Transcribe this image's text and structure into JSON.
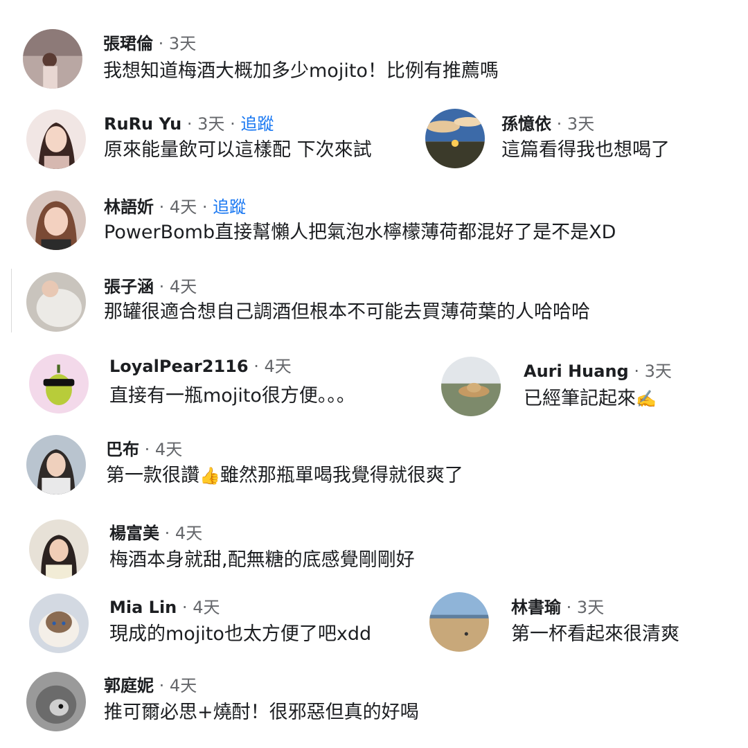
{
  "separator": "·",
  "follow_label": "追蹤",
  "colors": {
    "follow": "#1877f2",
    "meta": "#65676b",
    "text": "#1c1e21"
  },
  "comments": [
    {
      "name": "張珺倫",
      "time": "3天",
      "text": "我想知道梅酒大概加多少mojito！比例有推薦嗎"
    },
    {
      "name": "RuRu Yu",
      "time": "3天",
      "text": "原來能量飲可以這樣配 下次來試",
      "follow": true
    },
    {
      "name": "孫憶依",
      "time": "3天",
      "text": "這篇看得我也想喝了"
    },
    {
      "name": "林語妡",
      "time": "4天",
      "text": "PowerBomb直接幫懶人把氣泡水檸檬薄荷都混好了是不是XD",
      "follow": true
    },
    {
      "name": "張子涵",
      "time": "4天",
      "text": "那罐很適合想自己調酒但根本不可能去買薄荷葉的人哈哈哈"
    },
    {
      "name": "LoyalPear2116",
      "time": "4天",
      "text": "直接有一瓶mojito很方便。。。"
    },
    {
      "name": "Auri Huang",
      "time": "3天",
      "text": "已經筆記起來",
      "emoji": "✍️"
    },
    {
      "name": "巴布",
      "time": "4天",
      "text_before": "第一款很讚",
      "emoji": "👍",
      "text_after": "雖然那瓶單喝我覺得就很爽了"
    },
    {
      "name": "楊富美",
      "time": "4天",
      "text": "梅酒本身就甜,配無糖的底感覺剛剛好"
    },
    {
      "name": "Mia Lin",
      "time": "4天",
      "text": "現成的mojito也太方便了吧xdd"
    },
    {
      "name": "林書瑜",
      "time": "3天",
      "text": "第一杯看起來很清爽"
    },
    {
      "name": "郭庭妮",
      "time": "4天",
      "text": "推可爾必思+燒酎！很邪惡但真的好喝"
    }
  ]
}
